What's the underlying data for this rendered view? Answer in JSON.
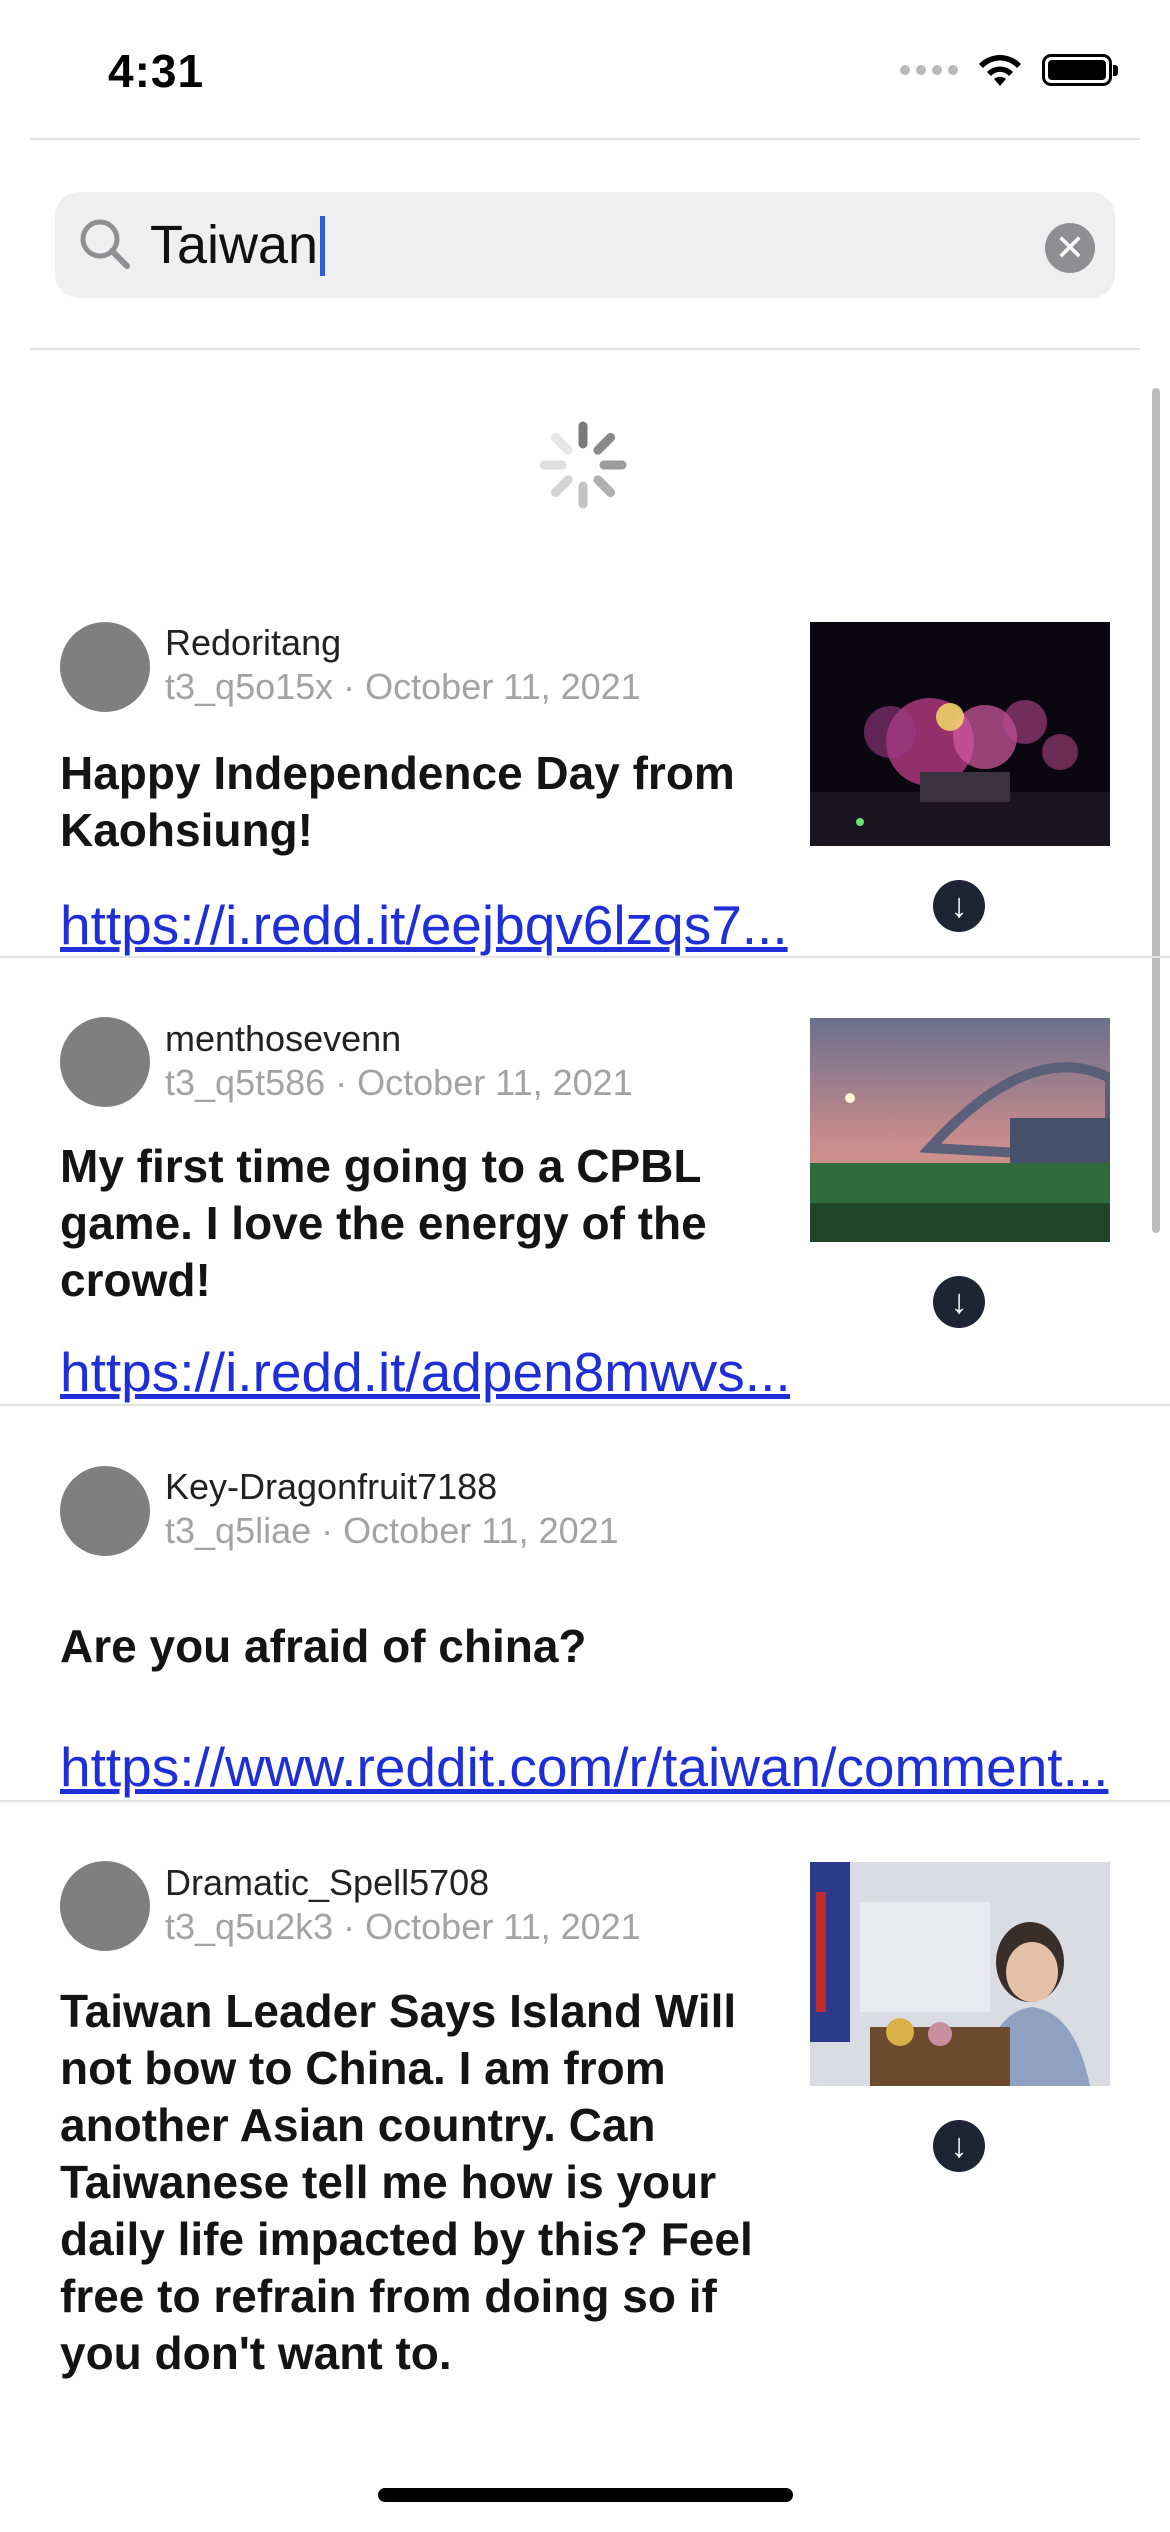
{
  "status_bar": {
    "time": "4:31"
  },
  "search": {
    "query": "Taiwan",
    "clear_label": "✕"
  },
  "posts": [
    {
      "author": "Redoritang",
      "id": "t3_q5o15x",
      "date": "October 11, 2021",
      "title": "Happy Independence Day from Kaohsiung!",
      "link": "https://i.redd.it/eejbqv6lzqs7...",
      "thumbnail": "fireworks-photo"
    },
    {
      "author": "menthosevenn",
      "id": "t3_q5t586",
      "date": "October 11, 2021",
      "title": "My first time going to a CPBL game. I love the energy of the crowd!",
      "link": "https://i.redd.it/adpen8mwvs...",
      "thumbnail": "baseball-stadium-photo"
    },
    {
      "author": "Key-Dragonfruit7188",
      "id": "t3_q5liae",
      "date": "October 11, 2021",
      "title": "Are you afraid of china?",
      "link": "https://www.reddit.com/r/taiwan/comment..."
    },
    {
      "author": "Dramatic_Spell5708",
      "id": "t3_q5u2k3",
      "date": "October 11, 2021",
      "title": "Taiwan Leader Says Island Will not bow to China. I am from another Asian country. Can Taiwanese tell me how is your daily life impacted by this? Feel free to refrain from doing so if you don't want to.",
      "thumbnail": "leader-speech-photo"
    }
  ],
  "meta_separator": " · ",
  "download_icon": "arrow-down-circle-icon",
  "colors": {
    "link": "#1f2fd8",
    "accent_caret": "#2d5bd8",
    "download_button": "#1d2433"
  }
}
